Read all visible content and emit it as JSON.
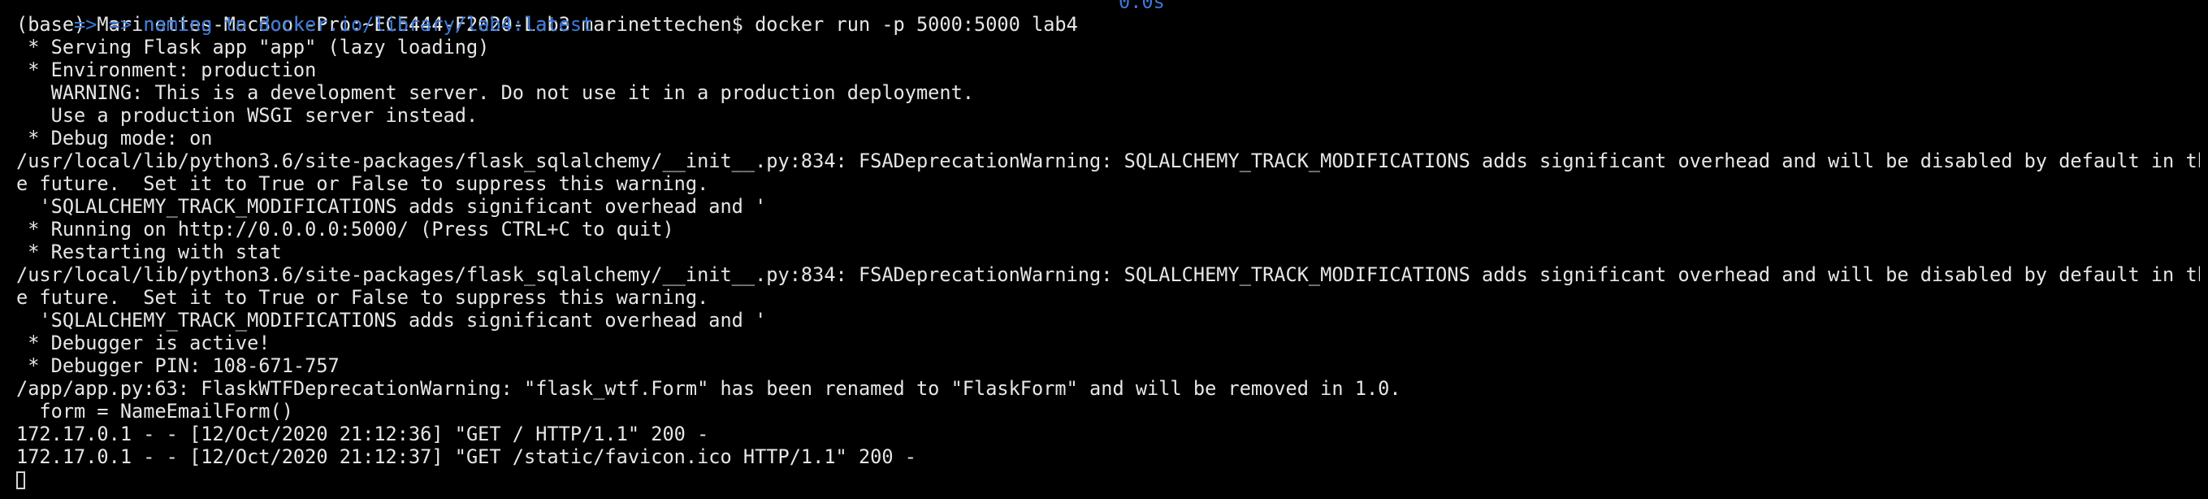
{
  "header_line": {
    "text": " => => naming to docker.io/library/lab4:latest",
    "time": "0.0s"
  },
  "lines": [
    "(base) Marinettes-MacBook-Pro:~ECE444-F2020-Lab3 marinettechen$ docker run -p 5000:5000 lab4",
    " * Serving Flask app \"app\" (lazy loading)",
    " * Environment: production",
    "   WARNING: This is a development server. Do not use it in a production deployment.",
    "   Use a production WSGI server instead.",
    " * Debug mode: on",
    "/usr/local/lib/python3.6/site-packages/flask_sqlalchemy/__init__.py:834: FSADeprecationWarning: SQLALCHEMY_TRACK_MODIFICATIONS adds significant overhead and will be disabled by default in th",
    "e future.  Set it to True or False to suppress this warning.",
    "  'SQLALCHEMY_TRACK_MODIFICATIONS adds significant overhead and '",
    " * Running on http://0.0.0.0:5000/ (Press CTRL+C to quit)",
    " * Restarting with stat",
    "/usr/local/lib/python3.6/site-packages/flask_sqlalchemy/__init__.py:834: FSADeprecationWarning: SQLALCHEMY_TRACK_MODIFICATIONS adds significant overhead and will be disabled by default in th",
    "e future.  Set it to True or False to suppress this warning.",
    "  'SQLALCHEMY_TRACK_MODIFICATIONS adds significant overhead and '",
    " * Debugger is active!",
    " * Debugger PIN: 108-671-757",
    "/app/app.py:63: FlaskWTFDeprecationWarning: \"flask_wtf.Form\" has been renamed to \"FlaskForm\" and will be removed in 1.0.",
    "  form = NameEmailForm()",
    "172.17.0.1 - - [12/Oct/2020 21:12:36] \"GET / HTTP/1.1\" 200 -",
    "172.17.0.1 - - [12/Oct/2020 21:12:37] \"GET /static/favicon.ico HTTP/1.1\" 200 -"
  ],
  "colors": {
    "background": "#000000",
    "text": "#e6e6e6",
    "progress_text": "#3b78d8"
  }
}
